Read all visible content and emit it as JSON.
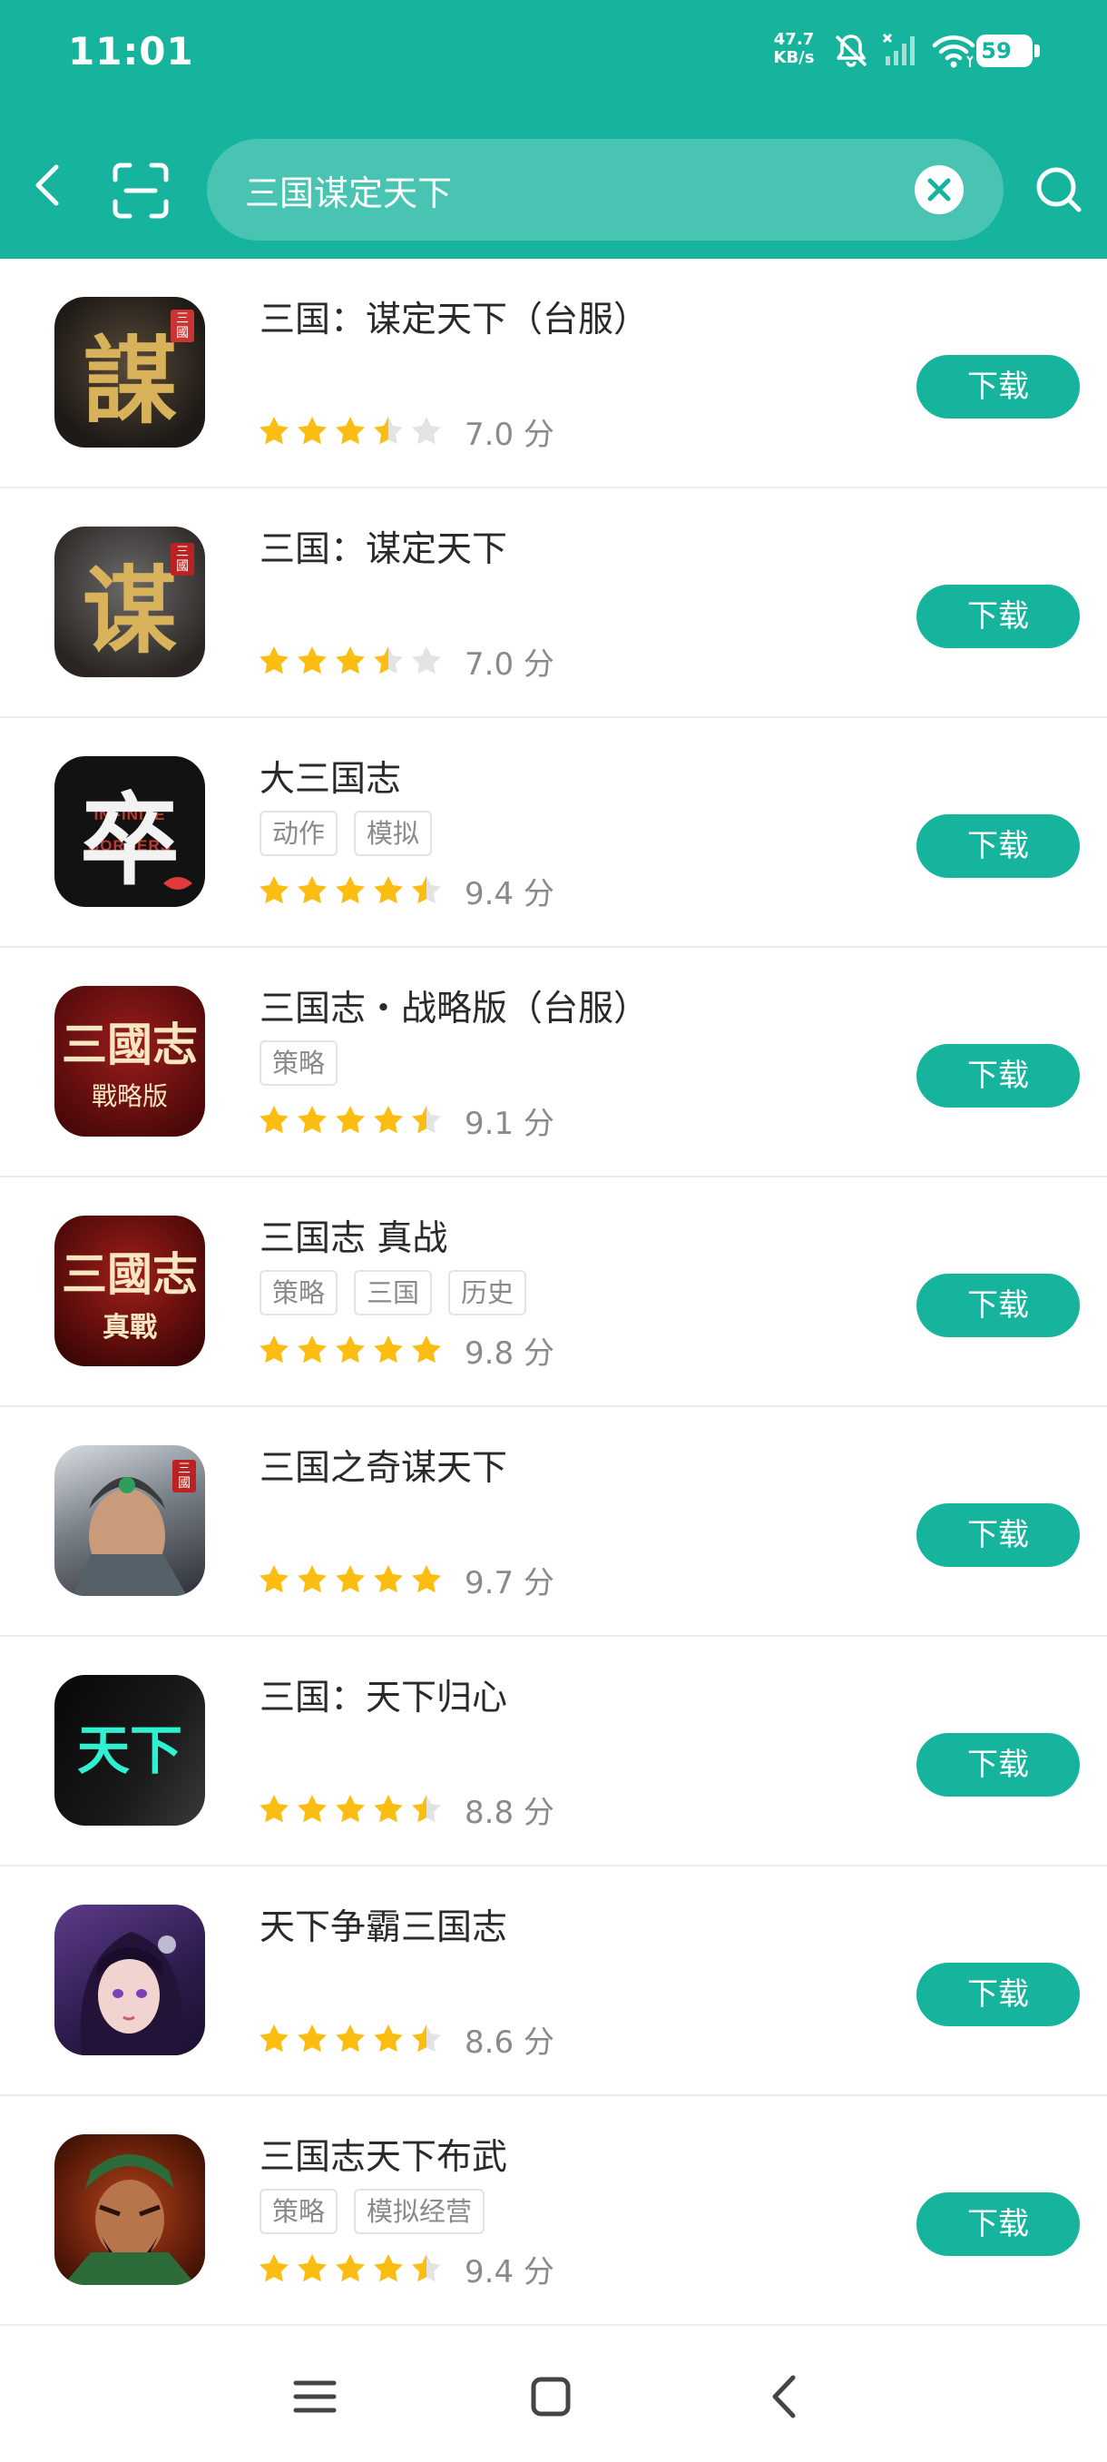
{
  "status_bar": {
    "time": "11:01",
    "net_speed_value": "47.7",
    "net_speed_unit": "KB/s",
    "battery": "59"
  },
  "search": {
    "query": "三国谋定天下",
    "icons": [
      "back-icon",
      "scan-icon",
      "clear-icon",
      "search-icon"
    ]
  },
  "apps": [
    {
      "name": "三国：谋定天下（台服）",
      "tags": [],
      "rating": 3.5,
      "score": "7.0 分",
      "download": "下载",
      "icon_text": "謀",
      "icon_badge": "三國"
    },
    {
      "name": "三国：谋定天下",
      "tags": [],
      "rating": 3.5,
      "score": "7.0 分",
      "download": "下载",
      "icon_text": "谋",
      "icon_badge": "三國"
    },
    {
      "name": "大三国志",
      "tags": [
        "动作",
        "模拟"
      ],
      "rating": 4.5,
      "score": "9.4 分",
      "download": "下载",
      "icon_text": "卒",
      "icon_badge": "INFINITE BORDERS"
    },
    {
      "name": "三国志・战略版（台服）",
      "tags": [
        "策略"
      ],
      "rating": 4.5,
      "score": "9.1 分",
      "download": "下载",
      "icon_text": "三國志",
      "icon_badge": "戰略版"
    },
    {
      "name": "三国志 真战",
      "tags": [
        "策略",
        "三国",
        "历史"
      ],
      "rating": 5,
      "score": "9.8 分",
      "download": "下载",
      "icon_text": "三國志",
      "icon_badge": "真戰"
    },
    {
      "name": "三国之奇谋天下",
      "tags": [],
      "rating": 5,
      "score": "9.7 分",
      "download": "下载",
      "icon_text": "",
      "icon_badge": "三國"
    },
    {
      "name": "三国：天下归心",
      "tags": [],
      "rating": 4.5,
      "score": "8.8 分",
      "download": "下载",
      "icon_text": "天下",
      "icon_badge": ""
    },
    {
      "name": "天下争霸三国志",
      "tags": [],
      "rating": 4.5,
      "score": "8.6 分",
      "download": "下载",
      "icon_text": "",
      "icon_badge": ""
    },
    {
      "name": "三国志天下布武",
      "tags": [
        "策略",
        "模拟经营"
      ],
      "rating": 4.5,
      "score": "9.4 分",
      "download": "下载",
      "icon_text": "",
      "icon_badge": ""
    }
  ],
  "colors": {
    "accent": "#16b39d",
    "star_on": "#fbbd12",
    "star_off": "#e3e3e3"
  },
  "nav_icons": [
    "menu-icon",
    "home-icon",
    "back-icon"
  ]
}
